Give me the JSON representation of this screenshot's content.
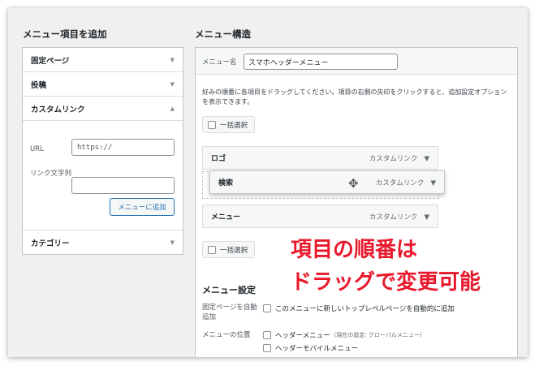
{
  "left": {
    "heading": "メニュー項目を追加",
    "sections": [
      {
        "label": "固定ページ"
      },
      {
        "label": "投稿"
      },
      {
        "label": "カスタムリンク"
      }
    ],
    "custom_link": {
      "url_label": "URL",
      "url_value": "https://",
      "text_label": "リンク文字列",
      "text_value": "",
      "add_button": "メニューに追加"
    },
    "last_section": "カテゴリー"
  },
  "right": {
    "heading": "メニュー構造",
    "menu_name_label": "メニュー名",
    "menu_name_value": "スマホヘッダーメニュー",
    "description": "好みの順番に各項目をドラッグしてください。項目の右側の矢印をクリックすると、追加設定オプションを表示できます。",
    "bulk_select": "一括選択",
    "items": [
      {
        "title": "ロゴ",
        "type": "カスタムリンク"
      },
      {
        "title": "検索",
        "type": "カスタムリンク"
      },
      {
        "title": "メニュー",
        "type": "カスタムリンク"
      }
    ],
    "settings_heading": "メニュー設定",
    "auto_add_label_1": "固定ページを自動",
    "auto_add_label_2": "追加",
    "auto_add_option": "このメニューに新しいトップレベルページを自動的に追加",
    "location_label": "メニューの位置",
    "location_1": "ヘッダーメニュー",
    "location_1_note": "(現在の設定: グローバルメニュー)",
    "location_2": "ヘッダーモバイルメニュー"
  },
  "annotation": {
    "line1": "項目の順番は",
    "line2": "ドラッグで変更可能",
    "color": "#e8192c"
  }
}
